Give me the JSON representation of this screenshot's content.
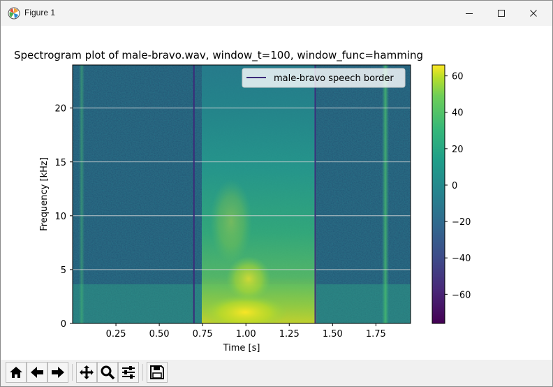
{
  "window": {
    "title": "Figure 1",
    "controls": [
      "minimize-icon",
      "maximize-icon",
      "close-icon"
    ]
  },
  "toolbar": {
    "buttons": [
      "home-icon",
      "back-arrow-icon",
      "forward-arrow-icon",
      "pan-icon",
      "zoom-icon",
      "configure-subplots-icon",
      "save-icon"
    ]
  },
  "chart_data": {
    "type": "heatmap",
    "title": "Spectrogram plot of male-bravo.wav, window_t=100, window_func=hamming",
    "xlabel": "Time [s]",
    "ylabel": "Frequency [kHz]",
    "xlim": [
      0.0,
      1.95
    ],
    "ylim": [
      0,
      24
    ],
    "xticks": [
      0.25,
      0.5,
      0.75,
      1.0,
      1.25,
      1.5,
      1.75
    ],
    "yticks": [
      0,
      5,
      10,
      15,
      20
    ],
    "grid": "horizontal",
    "colormap": "viridis",
    "colorbar": {
      "min": -76,
      "max": 66,
      "ticks": [
        60,
        40,
        20,
        0,
        -20,
        -40,
        -60
      ]
    },
    "series": [
      {
        "name": "male-bravo speech border",
        "type": "vline",
        "x": [
          0.7,
          1.4
        ],
        "color": "#3b2a7a"
      }
    ],
    "legend": {
      "placement": "top-right",
      "entries": [
        "male-bravo speech border"
      ]
    }
  }
}
